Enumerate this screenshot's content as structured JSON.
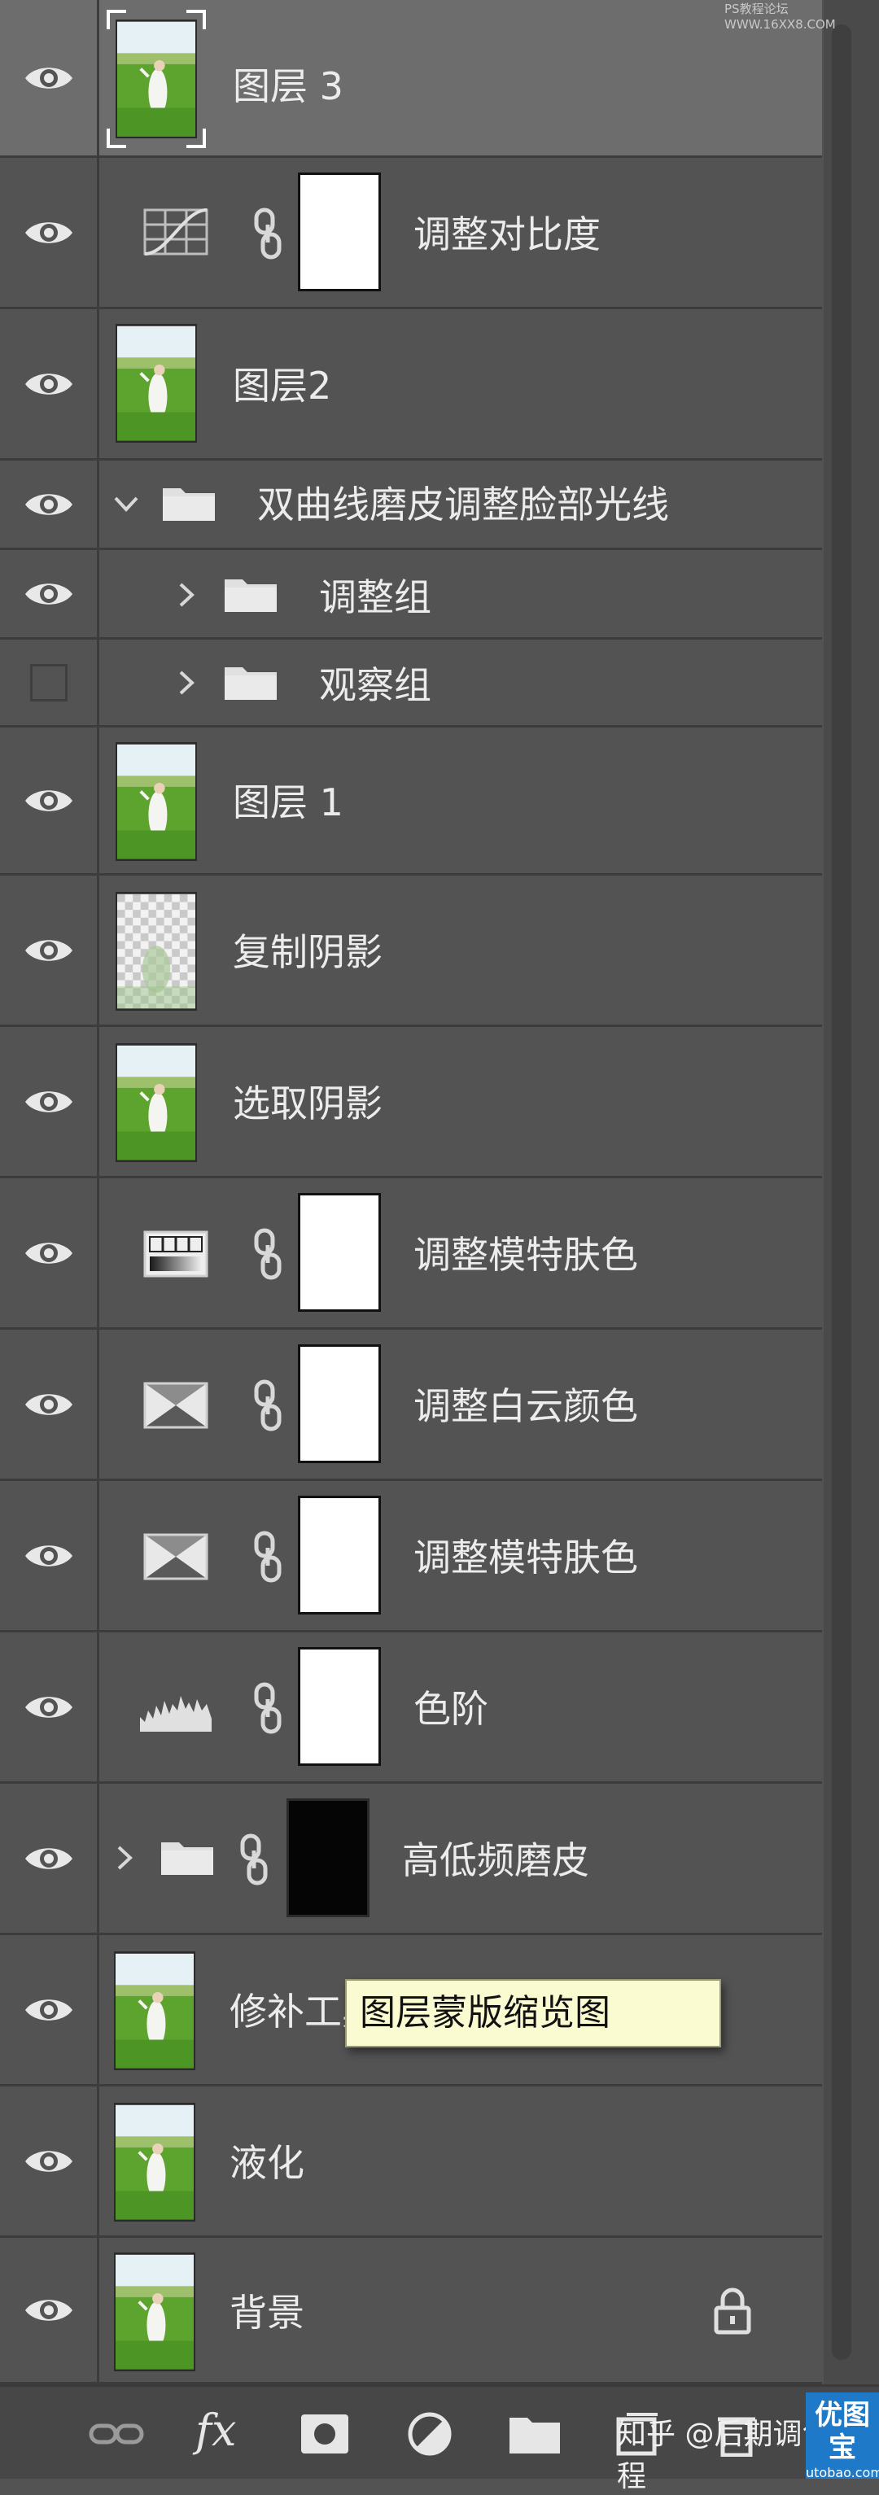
{
  "watermark_top": "PS教程论坛 WWW.16XX8.COM",
  "layers": [
    {
      "id": "layer3",
      "name": "图层 3",
      "kind": "image",
      "selected": true,
      "visible": true
    },
    {
      "id": "contrast",
      "name": "调整对比度",
      "kind": "adjustment",
      "icon": "curves-icon",
      "visible": true
    },
    {
      "id": "layer2",
      "name": "图层2",
      "kind": "image",
      "visible": true
    },
    {
      "id": "group-dodge",
      "name": "双曲线磨皮调整脸部光线",
      "kind": "group",
      "expanded": true,
      "visible": true
    },
    {
      "id": "group-adjust",
      "name": "调整组",
      "kind": "subgroup",
      "visible": true
    },
    {
      "id": "group-observe",
      "name": "观察组",
      "kind": "subgroup",
      "visible": false
    },
    {
      "id": "layer1",
      "name": "图层 1",
      "kind": "image",
      "visible": true
    },
    {
      "id": "copy-shadow",
      "name": "复制阴影",
      "kind": "transparent-image",
      "visible": true
    },
    {
      "id": "select-shadow",
      "name": "选取阴影",
      "kind": "image",
      "visible": true
    },
    {
      "id": "skin1",
      "name": "调整模特肤色",
      "kind": "adjustment",
      "icon": "gradient-map-icon",
      "visible": true
    },
    {
      "id": "cloud",
      "name": "调整白云颜色",
      "kind": "adjustment",
      "icon": "selective-color-icon",
      "visible": true
    },
    {
      "id": "skin2",
      "name": "调整模特肤色",
      "kind": "adjustment",
      "icon": "selective-color-icon",
      "visible": true
    },
    {
      "id": "levels",
      "name": "色阶",
      "kind": "adjustment",
      "icon": "levels-icon",
      "visible": true
    },
    {
      "id": "freq",
      "name": "高低频磨皮",
      "kind": "group-mask",
      "visible": true
    },
    {
      "id": "repair",
      "name": "修补工具",
      "kind": "image",
      "visible": true
    },
    {
      "id": "liquify",
      "name": "液化",
      "kind": "image",
      "visible": true
    },
    {
      "id": "background",
      "name": "背景",
      "kind": "image",
      "locked": true,
      "visible": true
    }
  ],
  "tooltip": "图层蒙版缩览图",
  "bottom_bar": {
    "icons": [
      "link-icon",
      "fx-icon",
      "mask-icon",
      "adjustment-icon",
      "folder-icon",
      "new-layer-icon",
      "trash-icon"
    ],
    "fx_label": "fx"
  },
  "watermark_zh": "知乎 @后期调色教程",
  "logo": {
    "line1": "优图宝",
    "line2": "utobao.com"
  }
}
